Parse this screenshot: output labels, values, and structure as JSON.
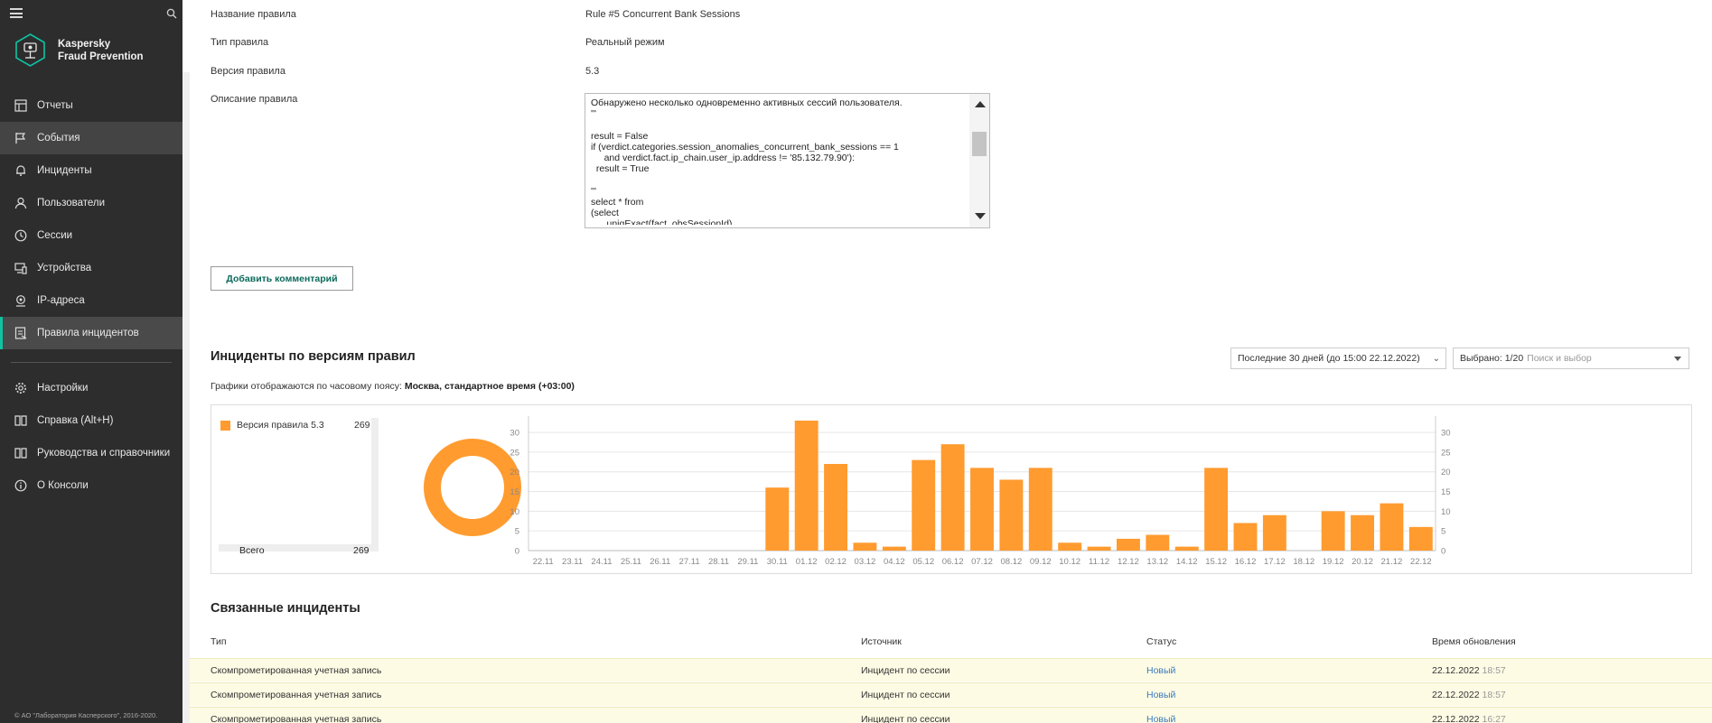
{
  "sidebar": {
    "brand_line1": "Kaspersky",
    "brand_line2": "Fraud Prevention",
    "nav": [
      {
        "label": "Отчеты",
        "icon": "reports-icon",
        "state": "normal"
      },
      {
        "label": "События",
        "icon": "flag-icon",
        "state": "active"
      },
      {
        "label": "Инциденты",
        "icon": "bell-icon",
        "state": "normal"
      },
      {
        "label": "Пользователи",
        "icon": "user-icon",
        "state": "normal"
      },
      {
        "label": "Сессии",
        "icon": "clock-icon",
        "state": "normal"
      },
      {
        "label": "Устройства",
        "icon": "device-icon",
        "state": "normal"
      },
      {
        "label": "IP-адреса",
        "icon": "location-icon",
        "state": "normal"
      },
      {
        "label": "Правила инцидентов",
        "icon": "rules-icon",
        "state": "selected"
      }
    ],
    "nav_bottom": [
      {
        "label": "Настройки",
        "icon": "gear-icon"
      },
      {
        "label": "Справка (Alt+H)",
        "icon": "book-icon"
      },
      {
        "label": "Руководства и справочники",
        "icon": "book-icon"
      },
      {
        "label": "О Консоли",
        "icon": "info-icon"
      }
    ],
    "copyright": "© АО \"Лаборатория Касперского\", 2016-2020."
  },
  "rule": {
    "name_label": "Название правила",
    "name_value": "Rule #5 Concurrent Bank Sessions",
    "type_label": "Тип правила",
    "type_value": "Реальный режим",
    "version_label": "Версия правила",
    "version_value": "5.3",
    "desc_label": "Описание правила",
    "desc_text": "Обнаружено несколько одновременно активных сессий пользователя.\n'''\n\nresult = False\nif (verdict.categories.session_anomalies_concurrent_bank_sessions == 1\n     and verdict.fact.ip_chain.user_ip.address != '85.132.79.90'):\n  result = True\n\n'''\nselect * from\n(select\n      uniqExact(fact_obsSessionId),"
  },
  "add_comment_button": "Добавить комментарий",
  "incidents_by_version": {
    "title": "Инциденты по версиям правил",
    "tz_prefix": "Графики отображаются по часовому поясу: ",
    "tz_value": "Москва, стандартное время (+03:00)",
    "period_select": "Последние 30 дней (до 15:00 22.12.2022)",
    "selected_label": "Выбрано: 1/20",
    "search_placeholder": "Поиск и выбор",
    "legend_name": "Версия правила 5.3",
    "legend_value": "269",
    "total_label": "Всего",
    "total_value": "269"
  },
  "colors": {
    "bar": "#ff9b2f",
    "accent": "#0ec3a2",
    "status_link": "#3a7bbf"
  },
  "chart_data": [
    {
      "type": "pie",
      "labels": [
        "Версия правила 5.3"
      ],
      "values": [
        269
      ]
    },
    {
      "type": "bar",
      "categories": [
        "22.11",
        "23.11",
        "24.11",
        "25.11",
        "26.11",
        "27.11",
        "28.11",
        "29.11",
        "30.11",
        "01.12",
        "02.12",
        "03.12",
        "04.12",
        "05.12",
        "06.12",
        "07.12",
        "08.12",
        "09.12",
        "10.12",
        "11.12",
        "12.12",
        "13.12",
        "14.12",
        "15.12",
        "16.12",
        "17.12",
        "18.12",
        "19.12",
        "20.12",
        "21.12",
        "22.12"
      ],
      "series": [
        {
          "name": "Версия правила 5.3",
          "values": [
            0,
            0,
            0,
            0,
            0,
            0,
            0,
            0,
            16,
            33,
            22,
            2,
            1,
            23,
            27,
            21,
            18,
            21,
            2,
            1,
            3,
            4,
            1,
            21,
            7,
            9,
            0,
            10,
            9,
            12,
            6
          ]
        }
      ],
      "yticks": [
        0,
        5,
        10,
        15,
        20,
        25,
        30
      ],
      "ylim": [
        0,
        33
      ]
    }
  ],
  "related": {
    "title": "Связанные инциденты",
    "columns": [
      "Тип",
      "Источник",
      "Статус",
      "Время обновления"
    ],
    "rows": [
      {
        "type": "Скомпрометированная учетная запись",
        "source": "Инцидент по сессии",
        "status": "Новый",
        "date": "22.12.2022",
        "time": "18:57"
      },
      {
        "type": "Скомпрометированная учетная запись",
        "source": "Инцидент по сессии",
        "status": "Новый",
        "date": "22.12.2022",
        "time": "18:57"
      },
      {
        "type": "Скомпрометированная учетная запись",
        "source": "Инцидент по сессии",
        "status": "Новый",
        "date": "22.12.2022",
        "time": "16:27"
      }
    ]
  }
}
